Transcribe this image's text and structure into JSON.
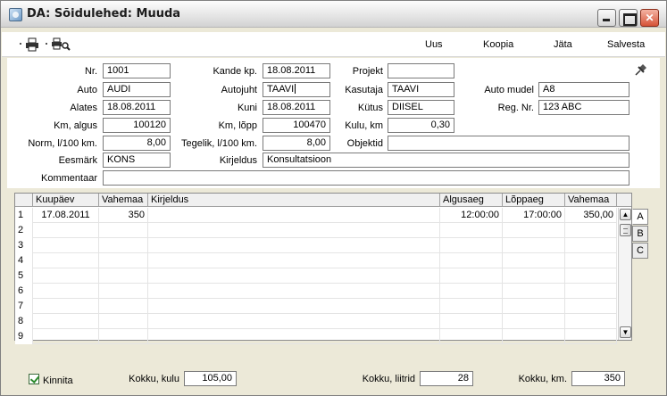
{
  "window": {
    "title": "DA: Sõidulehed: Muuda"
  },
  "toolbar": {
    "icons": [
      "printer-icon",
      "print-preview-icon"
    ],
    "new_label": "Uus",
    "copy_label": "Koopia",
    "discard_label": "Jäta",
    "save_label": "Salvesta"
  },
  "form": {
    "nr": {
      "label": "Nr.",
      "value": "1001"
    },
    "kande_kp": {
      "label": "Kande kp.",
      "value": "18.08.2011"
    },
    "projekt": {
      "label": "Projekt",
      "value": ""
    },
    "auto": {
      "label": "Auto",
      "value": "AUDI"
    },
    "autojuht": {
      "label": "Autojuht",
      "value": "TAAVI"
    },
    "kasutaja": {
      "label": "Kasutaja",
      "value": "TAAVI"
    },
    "auto_mudel": {
      "label": "Auto mudel",
      "value": "A8"
    },
    "alates": {
      "label": "Alates",
      "value": "18.08.2011"
    },
    "kuni": {
      "label": "Kuni",
      "value": "18.08.2011"
    },
    "kutus": {
      "label": "Kütus",
      "value": "DIISEL"
    },
    "reg_nr": {
      "label": "Reg. Nr.",
      "value": "123 ABC"
    },
    "km_algus": {
      "label": "Km, algus",
      "value": "100120"
    },
    "km_lopp": {
      "label": "Km, lõpp",
      "value": "100470"
    },
    "kulu_km": {
      "label": "Kulu, km",
      "value": "0,30"
    },
    "norm": {
      "label": "Norm, l/100 km.",
      "value": "8,00"
    },
    "tegelik": {
      "label": "Tegelik, l/100 km.",
      "value": "8,00"
    },
    "objektid": {
      "label": "Objektid",
      "value": ""
    },
    "eesmark": {
      "label": "Eesmärk",
      "value": "KONS"
    },
    "kirjeldus": {
      "label": "Kirjeldus",
      "value": "Konsultatsioon"
    },
    "kommentaar": {
      "label": "Kommentaar",
      "value": ""
    }
  },
  "grid": {
    "columns": [
      "",
      "Kuupäev",
      "Vahemaa",
      "Kirjeldus",
      "Algusaeg",
      "Lõppaeg",
      "Vahemaa"
    ],
    "rows": [
      {
        "n": "1",
        "kuupaev": "17.08.2011",
        "vahemaa": "350",
        "kirjeldus": "",
        "algusaeg": "12:00:00",
        "loppaeg": "17:00:00",
        "vahemaa2": "350,00"
      },
      {
        "n": "2",
        "kuupaev": "",
        "vahemaa": "",
        "kirjeldus": "",
        "algusaeg": "",
        "loppaeg": "",
        "vahemaa2": ""
      },
      {
        "n": "3",
        "kuupaev": "",
        "vahemaa": "",
        "kirjeldus": "",
        "algusaeg": "",
        "loppaeg": "",
        "vahemaa2": ""
      },
      {
        "n": "4",
        "kuupaev": "",
        "vahemaa": "",
        "kirjeldus": "",
        "algusaeg": "",
        "loppaeg": "",
        "vahemaa2": ""
      },
      {
        "n": "5",
        "kuupaev": "",
        "vahemaa": "",
        "kirjeldus": "",
        "algusaeg": "",
        "loppaeg": "",
        "vahemaa2": ""
      },
      {
        "n": "6",
        "kuupaev": "",
        "vahemaa": "",
        "kirjeldus": "",
        "algusaeg": "",
        "loppaeg": "",
        "vahemaa2": ""
      },
      {
        "n": "7",
        "kuupaev": "",
        "vahemaa": "",
        "kirjeldus": "",
        "algusaeg": "",
        "loppaeg": "",
        "vahemaa2": ""
      },
      {
        "n": "8",
        "kuupaev": "",
        "vahemaa": "",
        "kirjeldus": "",
        "algusaeg": "",
        "loppaeg": "",
        "vahemaa2": ""
      },
      {
        "n": "9",
        "kuupaev": "",
        "vahemaa": "",
        "kirjeldus": "",
        "algusaeg": "",
        "loppaeg": "",
        "vahemaa2": ""
      }
    ],
    "tabs": [
      "A",
      "B",
      "C"
    ]
  },
  "footer": {
    "kinnita_label": "Kinnita",
    "kokku_kulu": {
      "label": "Kokku, kulu",
      "value": "105,00"
    },
    "kokku_liitrid": {
      "label": "Kokku, liitrid",
      "value": "28"
    },
    "kokku_km": {
      "label": "Kokku, km.",
      "value": "350"
    }
  }
}
